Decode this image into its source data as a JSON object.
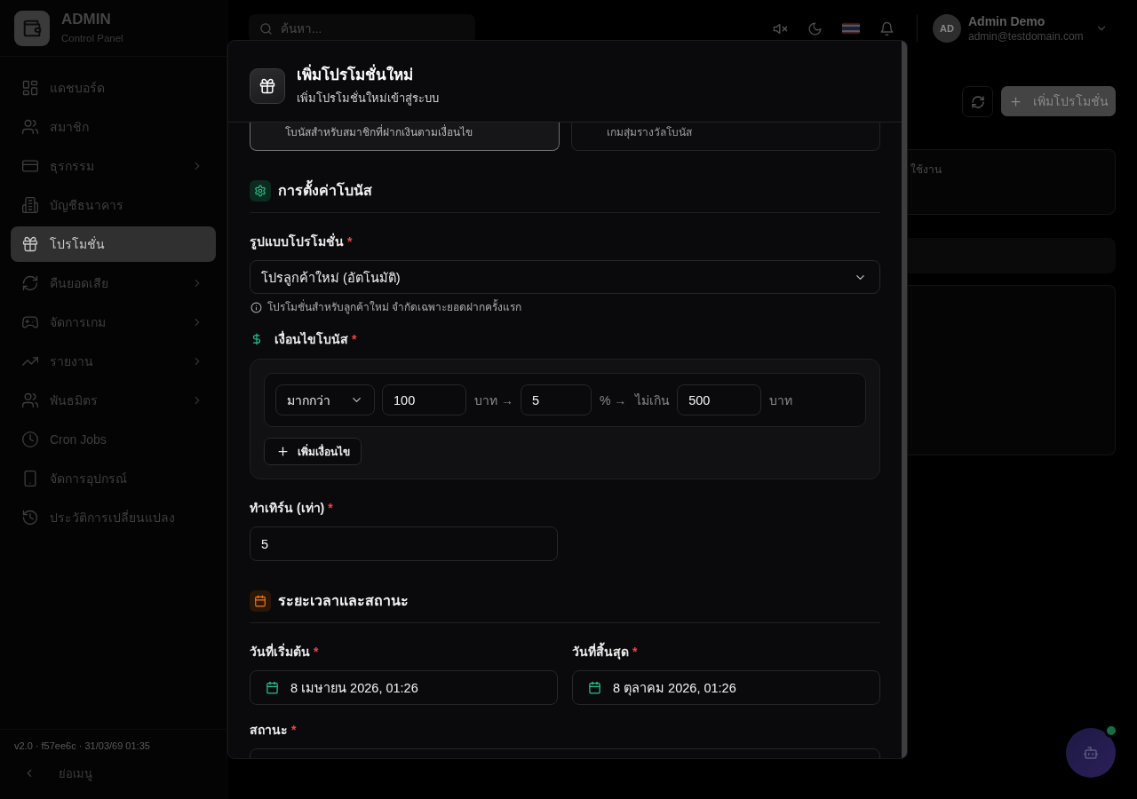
{
  "sidebar": {
    "brand": {
      "title": "ADMIN",
      "subtitle": "Control Panel"
    },
    "items": [
      {
        "label": "แดชบอร์ด",
        "selected": false,
        "has_submenu": false
      },
      {
        "label": "สมาชิก",
        "selected": false,
        "has_submenu": false
      },
      {
        "label": "ธุรกรรม",
        "selected": false,
        "has_submenu": true
      },
      {
        "label": "บัญชีธนาคาร",
        "selected": false,
        "has_submenu": false
      },
      {
        "label": "โปรโมชั่น",
        "selected": true,
        "has_submenu": false
      },
      {
        "label": "คืนยอดเสีย",
        "selected": false,
        "has_submenu": true
      },
      {
        "label": "จัดการเกม",
        "selected": false,
        "has_submenu": true
      },
      {
        "label": "รายงาน",
        "selected": false,
        "has_submenu": true
      },
      {
        "label": "พันธมิตร",
        "selected": false,
        "has_submenu": true
      },
      {
        "label": "Cron Jobs",
        "selected": false,
        "has_submenu": false
      },
      {
        "label": "จัดการอุปกรณ์",
        "selected": false,
        "has_submenu": false
      },
      {
        "label": "ประวัติการเปลี่ยนแปลง",
        "selected": false,
        "has_submenu": false
      }
    ],
    "build_info": "v2.0 · f57ee6c · 31/03/69 01:35",
    "collapse_label": "ย่อเมนู"
  },
  "topbar": {
    "search": {
      "placeholder": "ค้นหา..."
    },
    "user": {
      "initials": "AD",
      "name": "Admin Demo",
      "email": "admin@testdomain.com"
    }
  },
  "page": {
    "add_button": "เพิ่มโปรโมชั่น",
    "panel_text": "ใช้งาน"
  },
  "modal": {
    "title": "เพิ่มโปรโมชั่นใหม่",
    "subtitle": "เพิ่มโปรโมชั่นใหม่เข้าสู่ระบบ",
    "type_cards": [
      {
        "description": "โบนัสสำหรับสมาชิกที่ฝากเงินตามเงื่อนไข",
        "selected": true
      },
      {
        "description": "เกมสุ่มรางวัลโบนัส",
        "selected": false
      }
    ],
    "bonus_settings": {
      "heading": "การตั้งค่าโบนัส",
      "promo_type": {
        "label": "รูปแบบโปรโมชั่น",
        "required_mark": "*",
        "value": "โปรลูกค้าใหม่ (อัตโนมัติ)",
        "hint": "โปรโมชั่นสำหรับลูกค้าใหม่ จำกัดเฉพาะยอดฝากครั้งแรก"
      },
      "conditions": {
        "label": "เงื่อนไขโบนัส",
        "required_mark": "*",
        "rows": [
          {
            "operator": "มากกว่า",
            "amount": "100",
            "amount_unit": "บาท →",
            "percent": "5",
            "percent_unit": "% →",
            "cap_label": "ไม่เกิน",
            "cap": "500",
            "cap_unit": "บาท"
          }
        ],
        "add_button": "เพิ่มเงื่อนไข"
      },
      "turnover": {
        "label": "ทำเทิร์น (เท่า)",
        "required_mark": "*",
        "value": "5"
      }
    },
    "schedule": {
      "heading": "ระยะเวลาและสถานะ",
      "start_date": {
        "label": "วันที่เริ่มต้น",
        "required_mark": "*",
        "value": "8 เมษายน 2026, 01:26"
      },
      "end_date": {
        "label": "วันที่สิ้นสุด",
        "required_mark": "*",
        "value": "8 ตุลาคม 2026, 01:26"
      },
      "status": {
        "label": "สถานะ",
        "required_mark": "*"
      }
    }
  }
}
